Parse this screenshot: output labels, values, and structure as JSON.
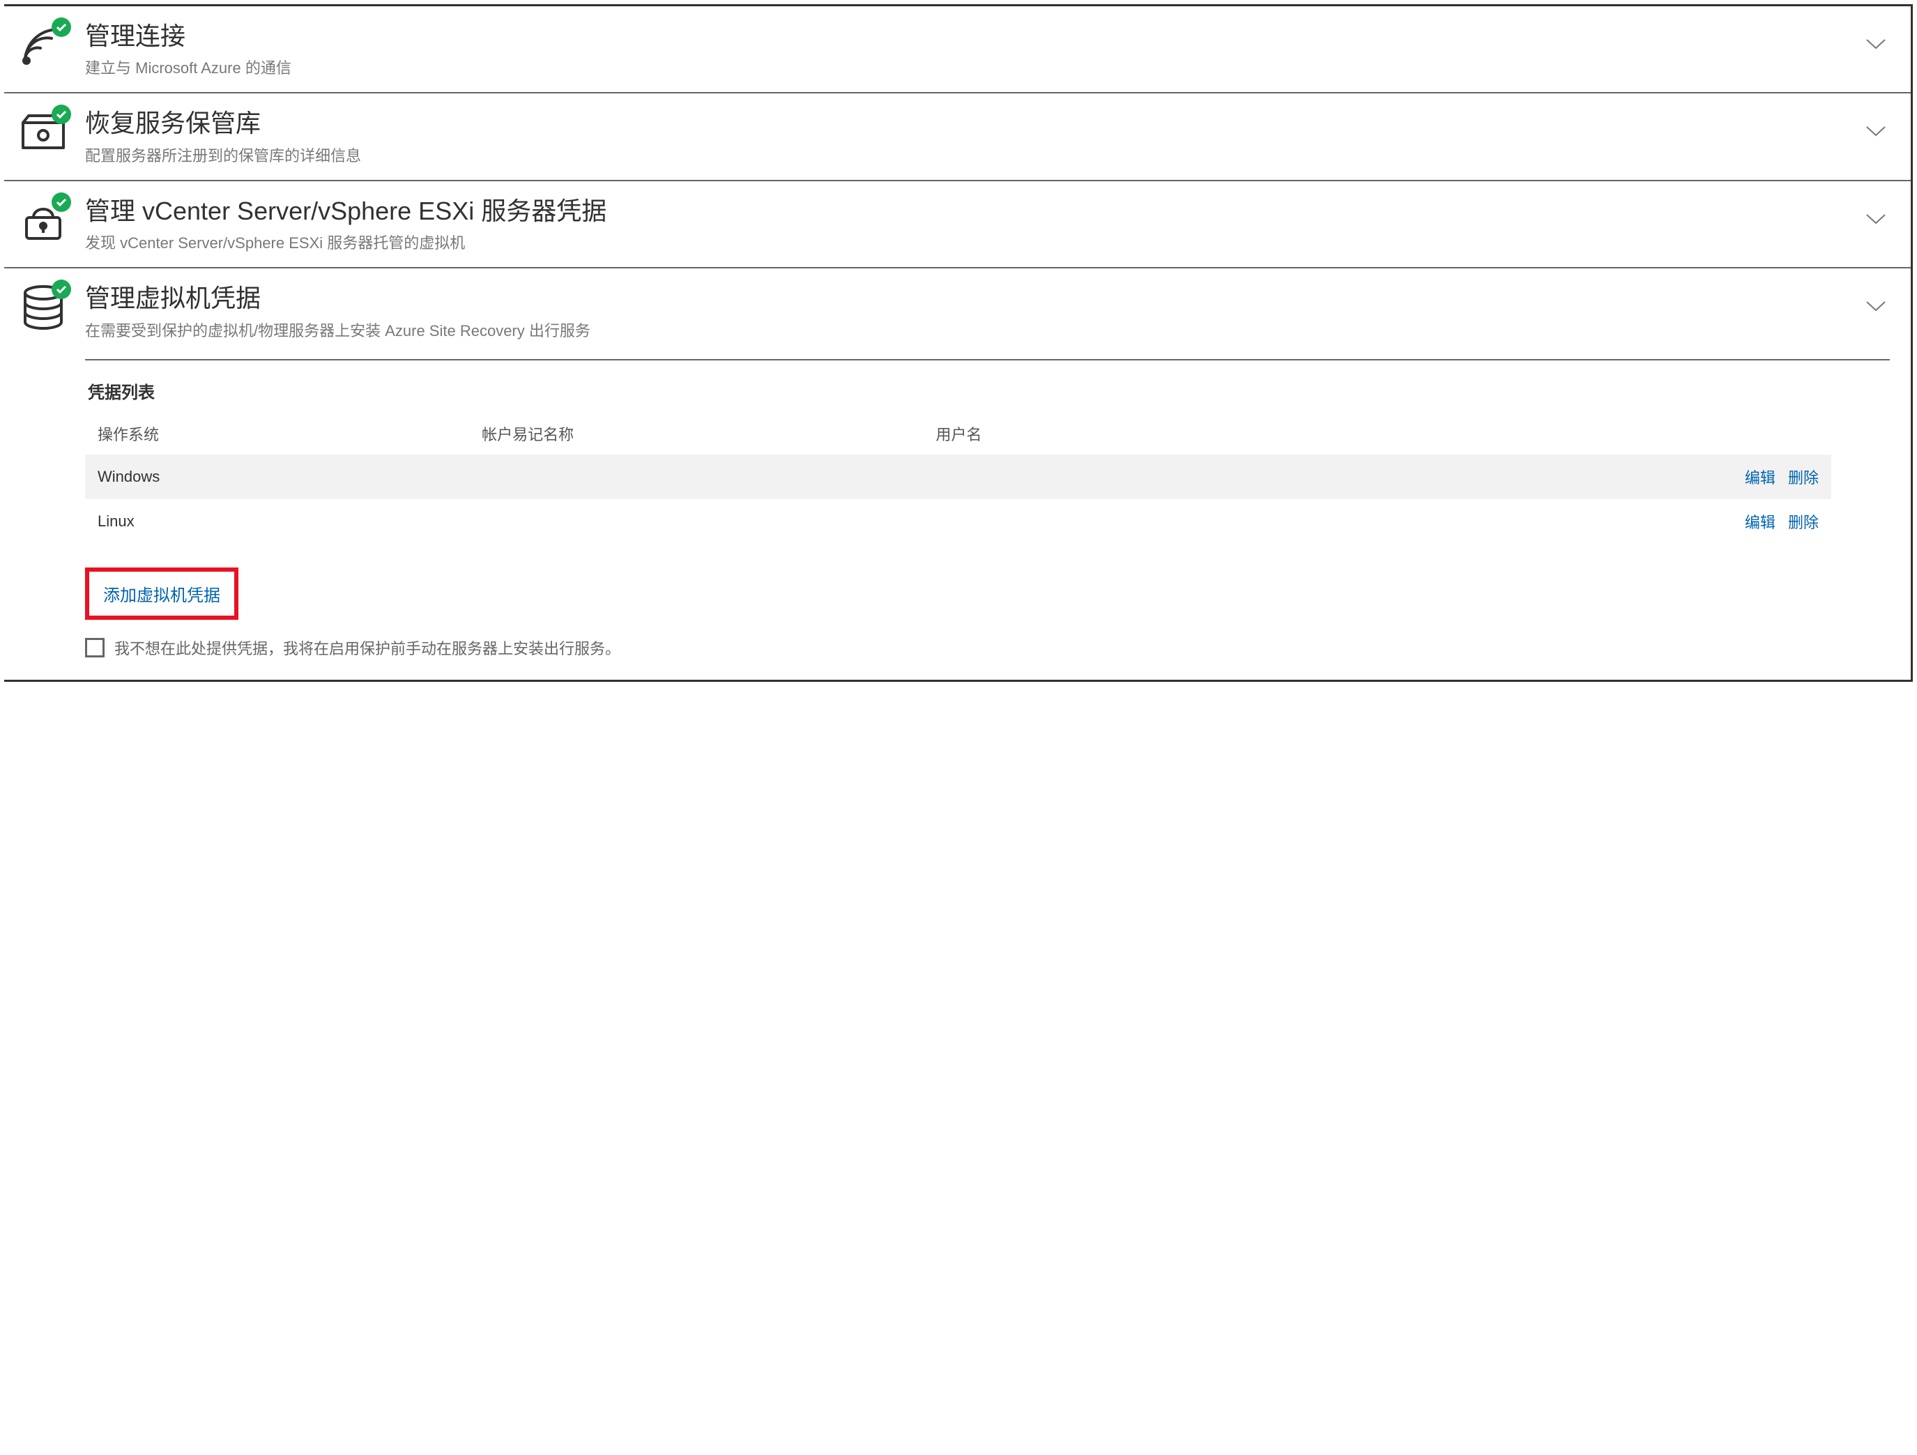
{
  "accordion": [
    {
      "title": "管理连接",
      "subtitle": "建立与 Microsoft Azure 的通信",
      "icon": "wifi",
      "status": "ok",
      "expanded": false
    },
    {
      "title": "恢复服务保管库",
      "subtitle": "配置服务器所注册到的保管库的详细信息",
      "icon": "drive",
      "status": "ok",
      "expanded": false
    },
    {
      "title": "管理 vCenter Server/vSphere ESXi 服务器凭据",
      "subtitle": "发现 vCenter Server/vSphere ESXi 服务器托管的虚拟机",
      "icon": "lock",
      "status": "ok",
      "expanded": false
    },
    {
      "title": "管理虚拟机凭据",
      "subtitle": "在需要受到保护的虚拟机/物理服务器上安装 Azure Site Recovery 出行服务",
      "icon": "database",
      "status": "ok",
      "expanded": true
    }
  ],
  "vmCreds": {
    "listHeading": "凭据列表",
    "columns": {
      "os": "操作系统",
      "friendly": "帐户易记名称",
      "username": "用户名"
    },
    "rows": [
      {
        "os": "Windows",
        "friendly": "",
        "username": ""
      },
      {
        "os": "Linux",
        "friendly": "",
        "username": ""
      }
    ],
    "actions": {
      "edit": "编辑",
      "delete": "删除"
    },
    "addButton": "添加虚拟机凭据",
    "skipCheckbox": {
      "checked": false,
      "label": "我不想在此处提供凭据，我将在启用保护前手动在服务器上安装出行服务。"
    }
  }
}
